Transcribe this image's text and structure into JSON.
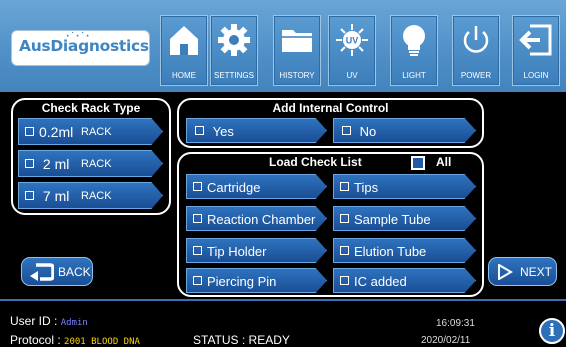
{
  "header": {
    "logo_text": "AusDiagnostics",
    "buttons": [
      {
        "label": "HOME",
        "icon": "home-icon"
      },
      {
        "label": "SETTINGS",
        "icon": "gear-icon"
      },
      {
        "label": "HISTORY",
        "icon": "folder-icon"
      },
      {
        "label": "UV",
        "icon": "uv-icon"
      },
      {
        "label": "LIGHT",
        "icon": "lightbulb-icon"
      },
      {
        "label": "POWER",
        "icon": "power-icon"
      },
      {
        "label": "LOGIN",
        "icon": "login-icon"
      }
    ],
    "uv_badge": "UV"
  },
  "rack": {
    "title": "Check Rack Type",
    "options": [
      {
        "size": "0.2ml",
        "unit": "RACK"
      },
      {
        "size": "2 ml",
        "unit": "RACK"
      },
      {
        "size": "7 ml",
        "unit": "RACK"
      }
    ]
  },
  "internal_control": {
    "title": "Add Internal Control",
    "yes": "Yes",
    "no": "No"
  },
  "checklist": {
    "title": "Load Check List",
    "all": "All",
    "left": [
      "Cartridge",
      "Reaction Chamber",
      "Tip Holder",
      "Piercing Pin"
    ],
    "right": [
      "Tips",
      "Sample Tube",
      "Elution Tube",
      "IC added"
    ]
  },
  "nav": {
    "back": "BACK",
    "next": "NEXT"
  },
  "footer": {
    "user_label": "User ID :",
    "user_value": "Admin",
    "protocol_label": "Protocol :",
    "protocol_value": "2001 BLOOD DNA",
    "status": "STATUS : READY",
    "time": "16:09:31",
    "date": "2020/02/11",
    "info": "i"
  },
  "colors": {
    "accent": "#1f5aa3",
    "header": "#4f8fc7",
    "value_yellow": "#ffd400"
  }
}
